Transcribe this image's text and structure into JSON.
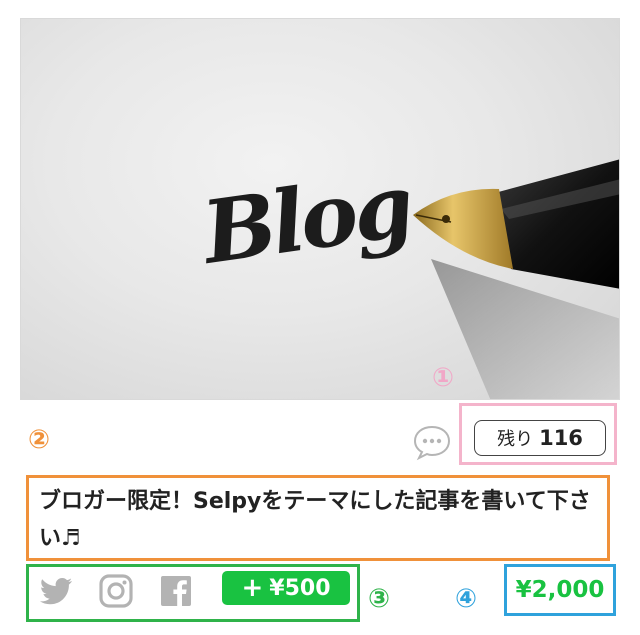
{
  "image": {
    "handwriting_text": "Blog",
    "alt": "Blog"
  },
  "annotations": {
    "m1": "①",
    "m2": "②",
    "m3": "③",
    "m4": "④"
  },
  "remaining": {
    "label": "残り",
    "count": "116"
  },
  "title": {
    "text": "ブロガー限定！Selpyをテーマにした記事を書いて下さい♬"
  },
  "share": {
    "icons": [
      "twitter-icon",
      "instagram-icon",
      "facebook-icon"
    ],
    "bonus_plus": "+",
    "bonus_amount": "¥500"
  },
  "price": {
    "value": "¥2,000"
  },
  "colors": {
    "green": "#19c241",
    "annotation_pink": "#f4b4cb",
    "annotation_orange": "#f0913a",
    "annotation_green": "#2fb34a",
    "annotation_blue": "#2fa2dc"
  }
}
